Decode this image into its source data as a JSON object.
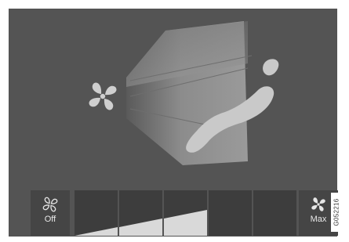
{
  "caption_fragment": "",
  "fan_control": {
    "off_label": "Off",
    "max_label": "Max",
    "level_count": 5,
    "current_level_fraction": 0.55
  },
  "figure_code": "G052216",
  "colors": {
    "screen_background": "#545454",
    "button_background": "#454545",
    "level_background": "#3d3d3d",
    "level_fill": "#d9d9d9",
    "icon_light": "#cfcfcf"
  },
  "icons": {
    "off_icon": "fan-outline-icon",
    "max_icon": "fan-filled-icon",
    "center_icon": "fan-filled-icon",
    "occupant_icon": "seated-person-icon"
  }
}
